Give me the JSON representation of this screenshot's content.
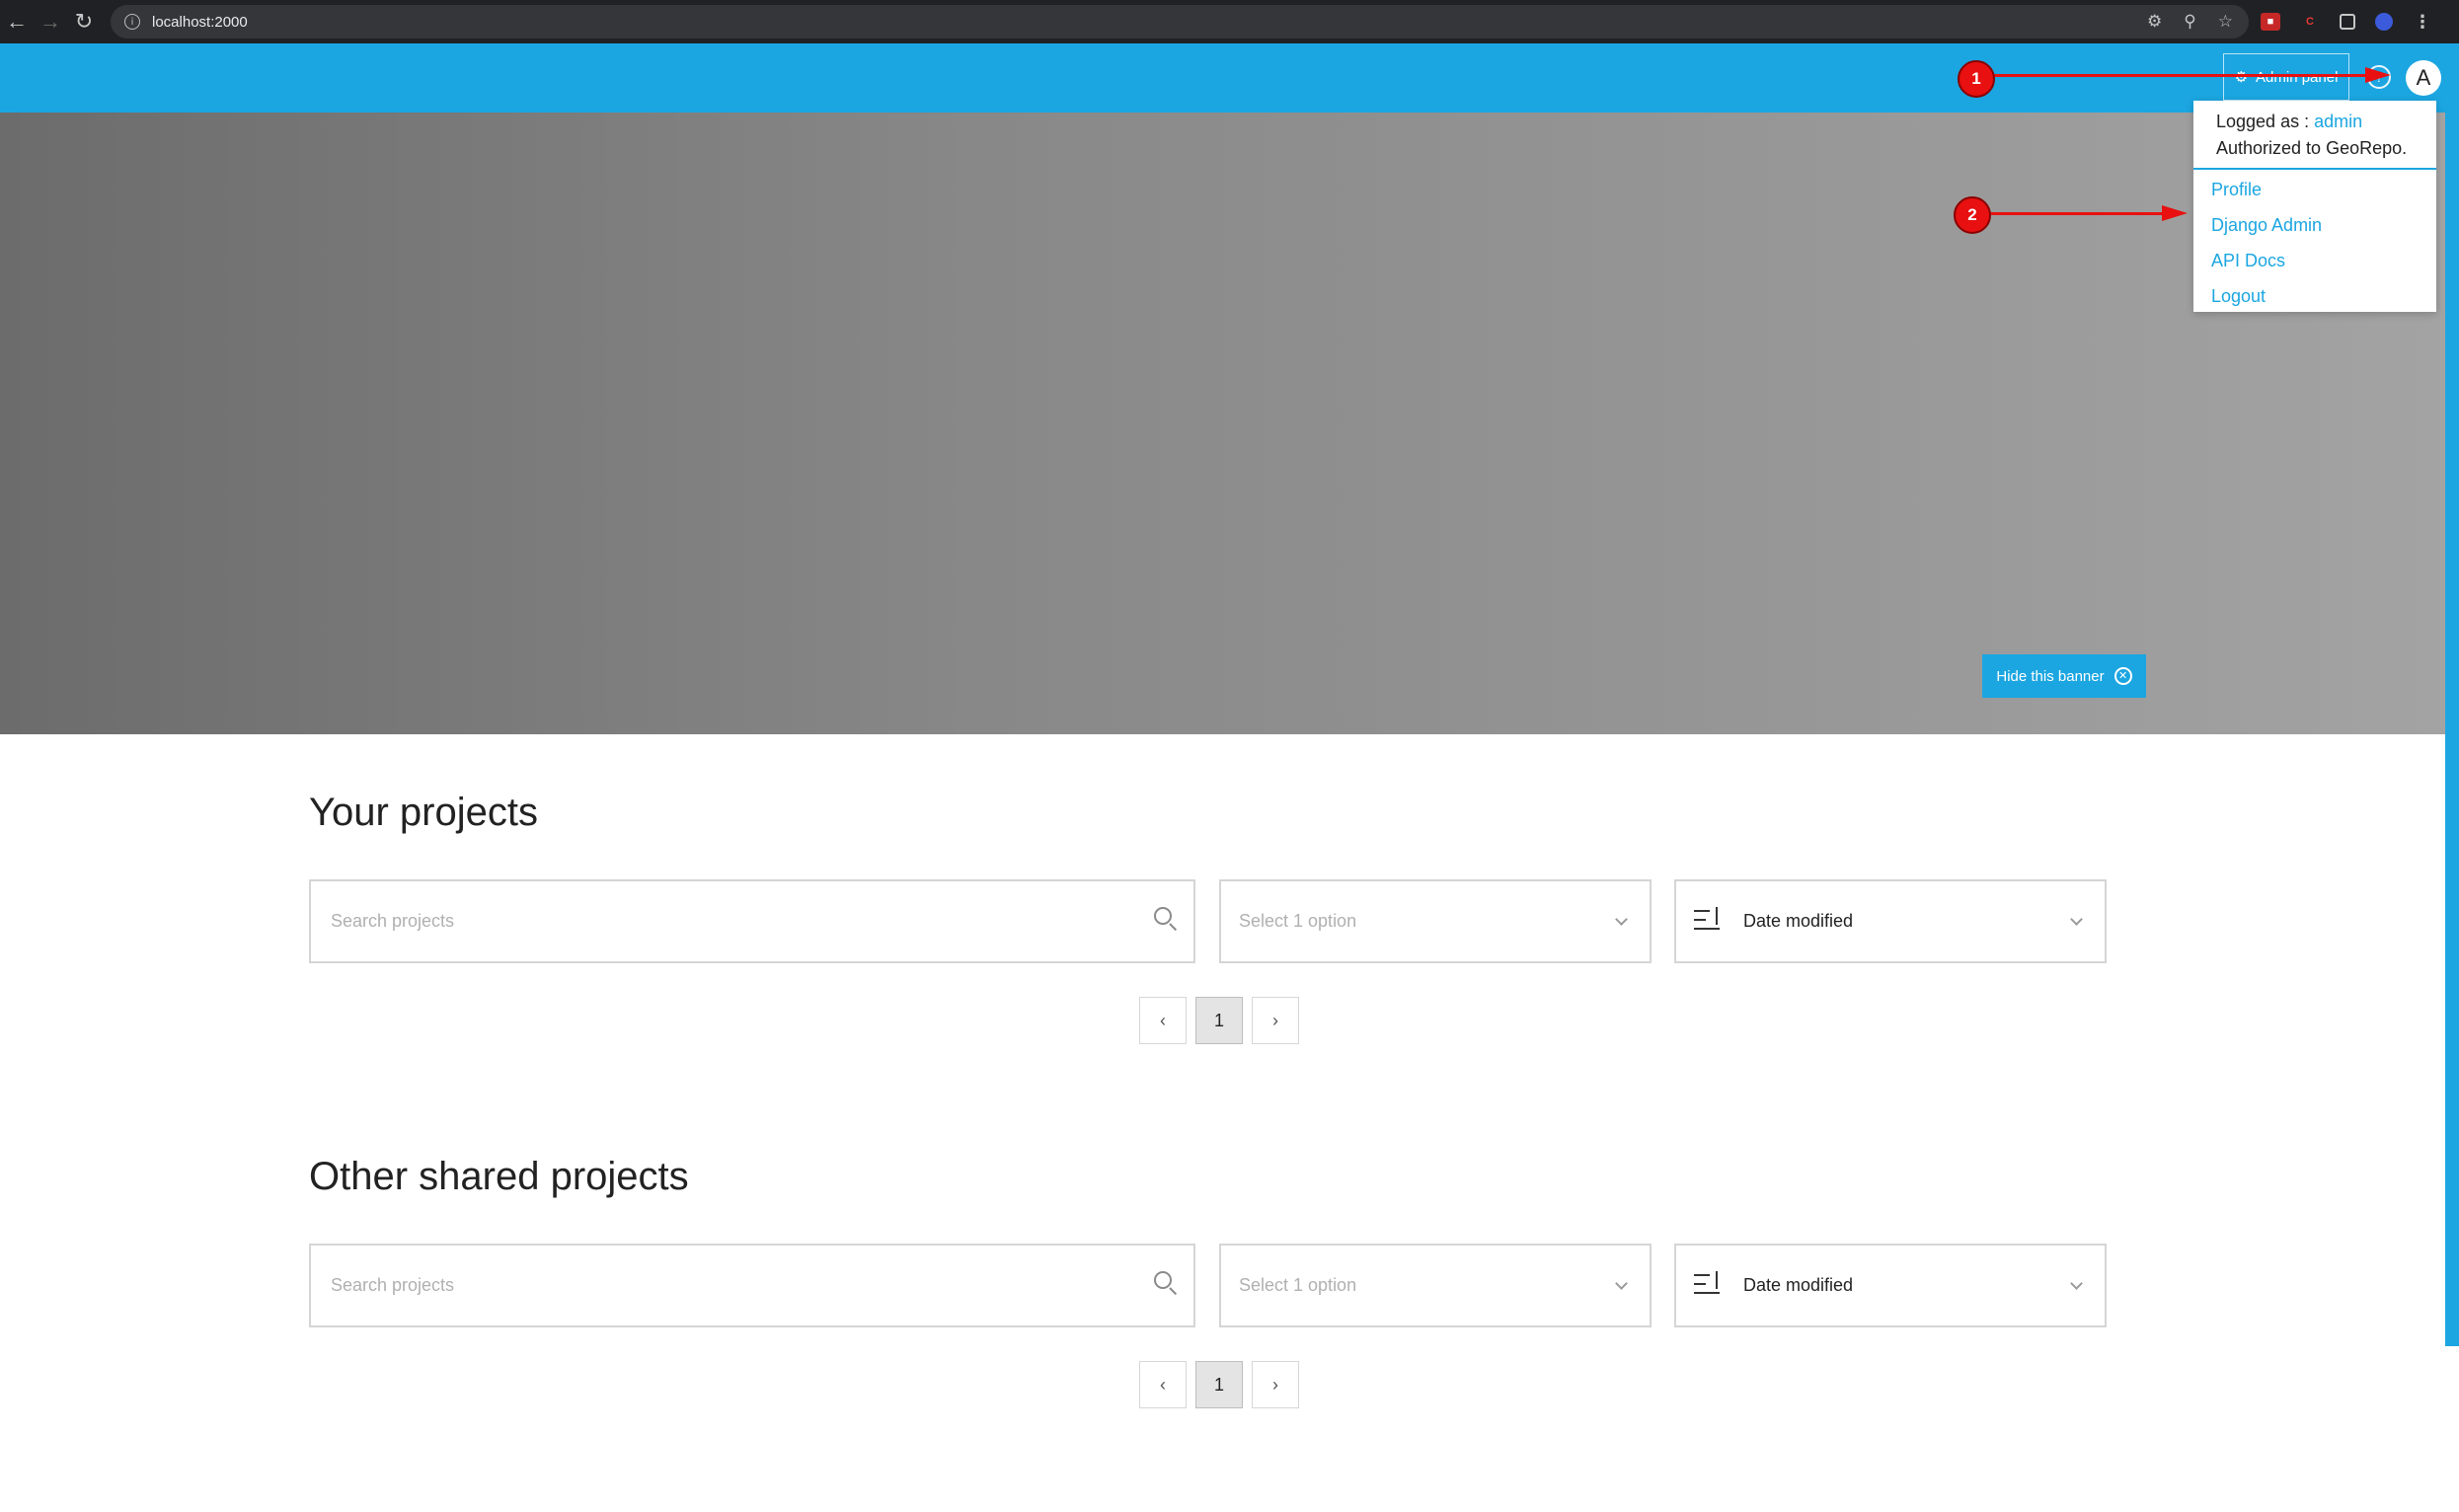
{
  "browser": {
    "url": "localhost:2000",
    "nav": {
      "back_icon": "arrow-left-icon",
      "forward_icon": "arrow-right-icon",
      "reload_icon": "reload-icon"
    },
    "omnibox_icons": [
      "key-icon",
      "zoom-icon",
      "star-icon"
    ]
  },
  "header": {
    "admin_panel_label": "Admin panel",
    "avatar_letter": "A",
    "accent_color": "#1ba6e1"
  },
  "user_menu": {
    "logged_as_prefix": "Logged as :",
    "username": "admin",
    "authorized_text": "Authorized to GeoRepo.",
    "items": [
      "Profile",
      "Django Admin",
      "API Docs",
      "Logout"
    ]
  },
  "banner": {
    "hide_label": "Hide this banner"
  },
  "annotations": {
    "badge_1": "1",
    "badge_2": "2",
    "color": "#e81010"
  },
  "sections": [
    {
      "title": "Your projects",
      "search_placeholder": "Search projects",
      "filter_placeholder": "Select 1 option",
      "sort_label": "Date modified",
      "current_page": "1"
    },
    {
      "title": "Other shared projects",
      "search_placeholder": "Search projects",
      "filter_placeholder": "Select 1 option",
      "sort_label": "Date modified",
      "current_page": "1"
    }
  ]
}
